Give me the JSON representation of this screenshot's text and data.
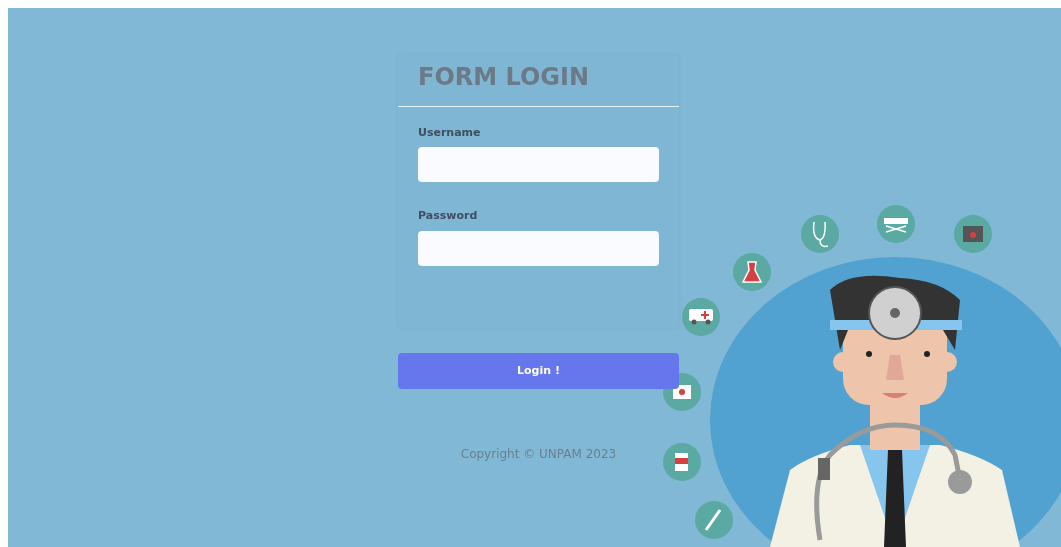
{
  "form": {
    "title": "FORM LOGIN",
    "fields": [
      {
        "label": "Username"
      },
      {
        "label": "Password"
      }
    ],
    "submit_button": "Login !"
  },
  "footer": {
    "copyright": "Copyright © UNPAM 2023"
  }
}
